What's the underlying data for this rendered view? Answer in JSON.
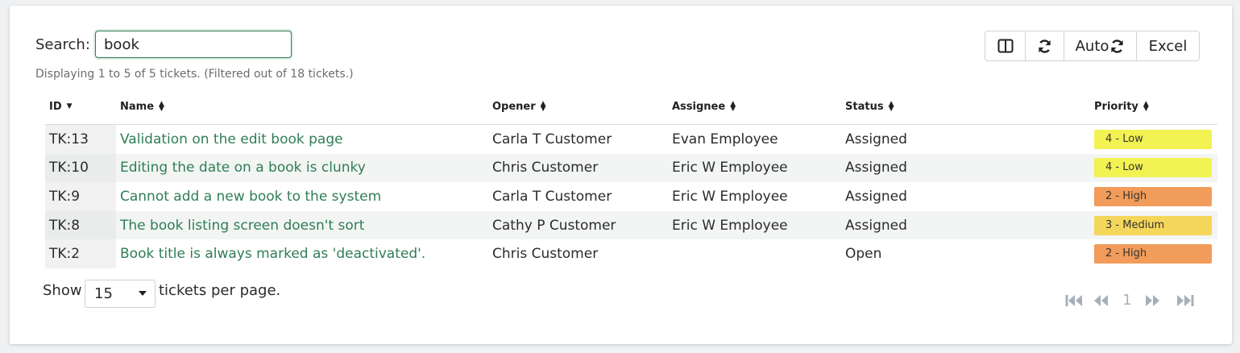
{
  "search": {
    "label": "Search:",
    "value": "book"
  },
  "info": "Displaying 1 to 5 of 5 tickets. (Filtered out of 18 tickets.)",
  "toolbar": {
    "columns_icon": "columns-icon",
    "refresh_icon": "refresh-icon",
    "auto_label": "Auto",
    "auto_icon": "refresh-icon",
    "excel_label": "Excel"
  },
  "table": {
    "headers": {
      "id": "ID",
      "name": "Name",
      "opener": "Opener",
      "assignee": "Assignee",
      "status": "Status",
      "priority": "Priority"
    },
    "rows": [
      {
        "id": "TK:13",
        "name": "Validation on the edit book page",
        "opener": "Carla T Customer",
        "assignee": "Evan Employee",
        "status": "Assigned",
        "priority": "4 - Low",
        "priority_color": "#f2f252"
      },
      {
        "id": "TK:10",
        "name": "Editing the date on a book is clunky",
        "opener": "Chris Customer",
        "assignee": "Eric W Employee",
        "status": "Assigned",
        "priority": "4 - Low",
        "priority_color": "#f2f252"
      },
      {
        "id": "TK:9",
        "name": "Cannot add a new book to the system",
        "opener": "Carla T Customer",
        "assignee": "Eric W Employee",
        "status": "Assigned",
        "priority": "2 - High",
        "priority_color": "#f19c5a"
      },
      {
        "id": "TK:8",
        "name": "The book listing screen doesn't sort",
        "opener": "Cathy P Customer",
        "assignee": "Eric W Employee",
        "status": "Assigned",
        "priority": "3 - Medium",
        "priority_color": "#f4d65a"
      },
      {
        "id": "TK:2",
        "name": "Book title is always marked as 'deactivated'.",
        "opener": "Chris Customer",
        "assignee": "",
        "status": "Open",
        "priority": "2 - High",
        "priority_color": "#f19c5a"
      }
    ]
  },
  "footer": {
    "show_label": "Show",
    "per_page_value": "15",
    "per_page_suffix": "tickets per page."
  },
  "pager": {
    "current_page": "1",
    "icons": [
      "first-page-icon",
      "previous-page-icon",
      "next-page-icon",
      "last-page-icon"
    ]
  },
  "colors": {
    "accent": "#2f7d57",
    "priority_low": "#f2f252",
    "priority_medium": "#f4d65a",
    "priority_high": "#f19c5a"
  }
}
